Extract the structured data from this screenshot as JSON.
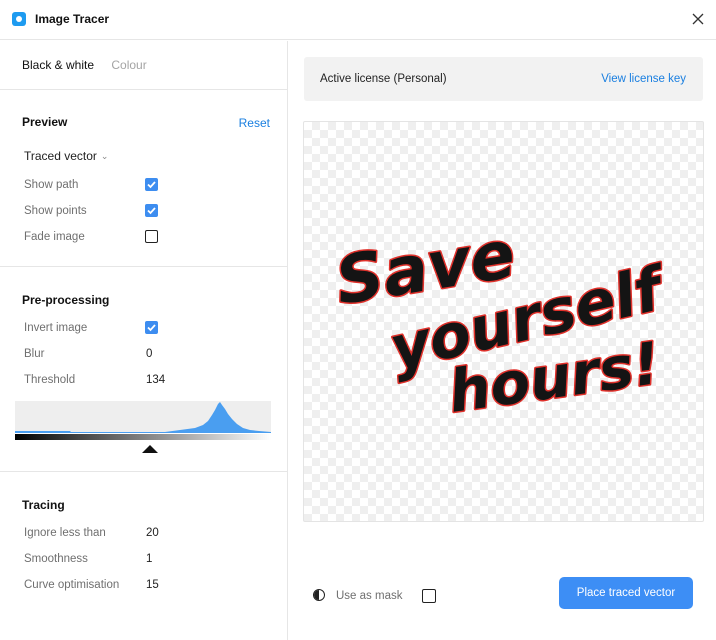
{
  "window": {
    "title": "Image Tracer",
    "icon": "app-icon"
  },
  "mode_tabs": [
    {
      "label": "Black & white",
      "active": true
    },
    {
      "label": "Colour",
      "active": false
    }
  ],
  "preview": {
    "title": "Preview",
    "reset_label": "Reset",
    "dropdown_value": "Traced vector",
    "rows": [
      {
        "label": "Show path",
        "checked": true
      },
      {
        "label": "Show points",
        "checked": true
      },
      {
        "label": "Fade image",
        "checked": false
      }
    ]
  },
  "preprocessing": {
    "title": "Pre-processing",
    "invert_label": "Invert image",
    "invert_checked": true,
    "blur_label": "Blur",
    "blur_value": "0",
    "threshold_label": "Threshold",
    "threshold_value": "134"
  },
  "tracing": {
    "title": "Tracing",
    "rows": [
      {
        "label": "Ignore less than",
        "value": "20"
      },
      {
        "label": "Smoothness",
        "value": "1"
      },
      {
        "label": "Curve optimisation",
        "value": "15"
      }
    ]
  },
  "license": {
    "text": "Active license (Personal)",
    "link": "View license key"
  },
  "canvas": {
    "lines": [
      "Save",
      "yourself",
      "hours!"
    ]
  },
  "mask": {
    "label": "Use as mask",
    "checked": false
  },
  "place_button": "Place traced vector",
  "colors": {
    "accent": "#3d8ef5",
    "link": "#1a7fe0",
    "histogram": "#4a9ef0",
    "trace_fill": "#141414",
    "trace_outline": "#e0312b"
  }
}
